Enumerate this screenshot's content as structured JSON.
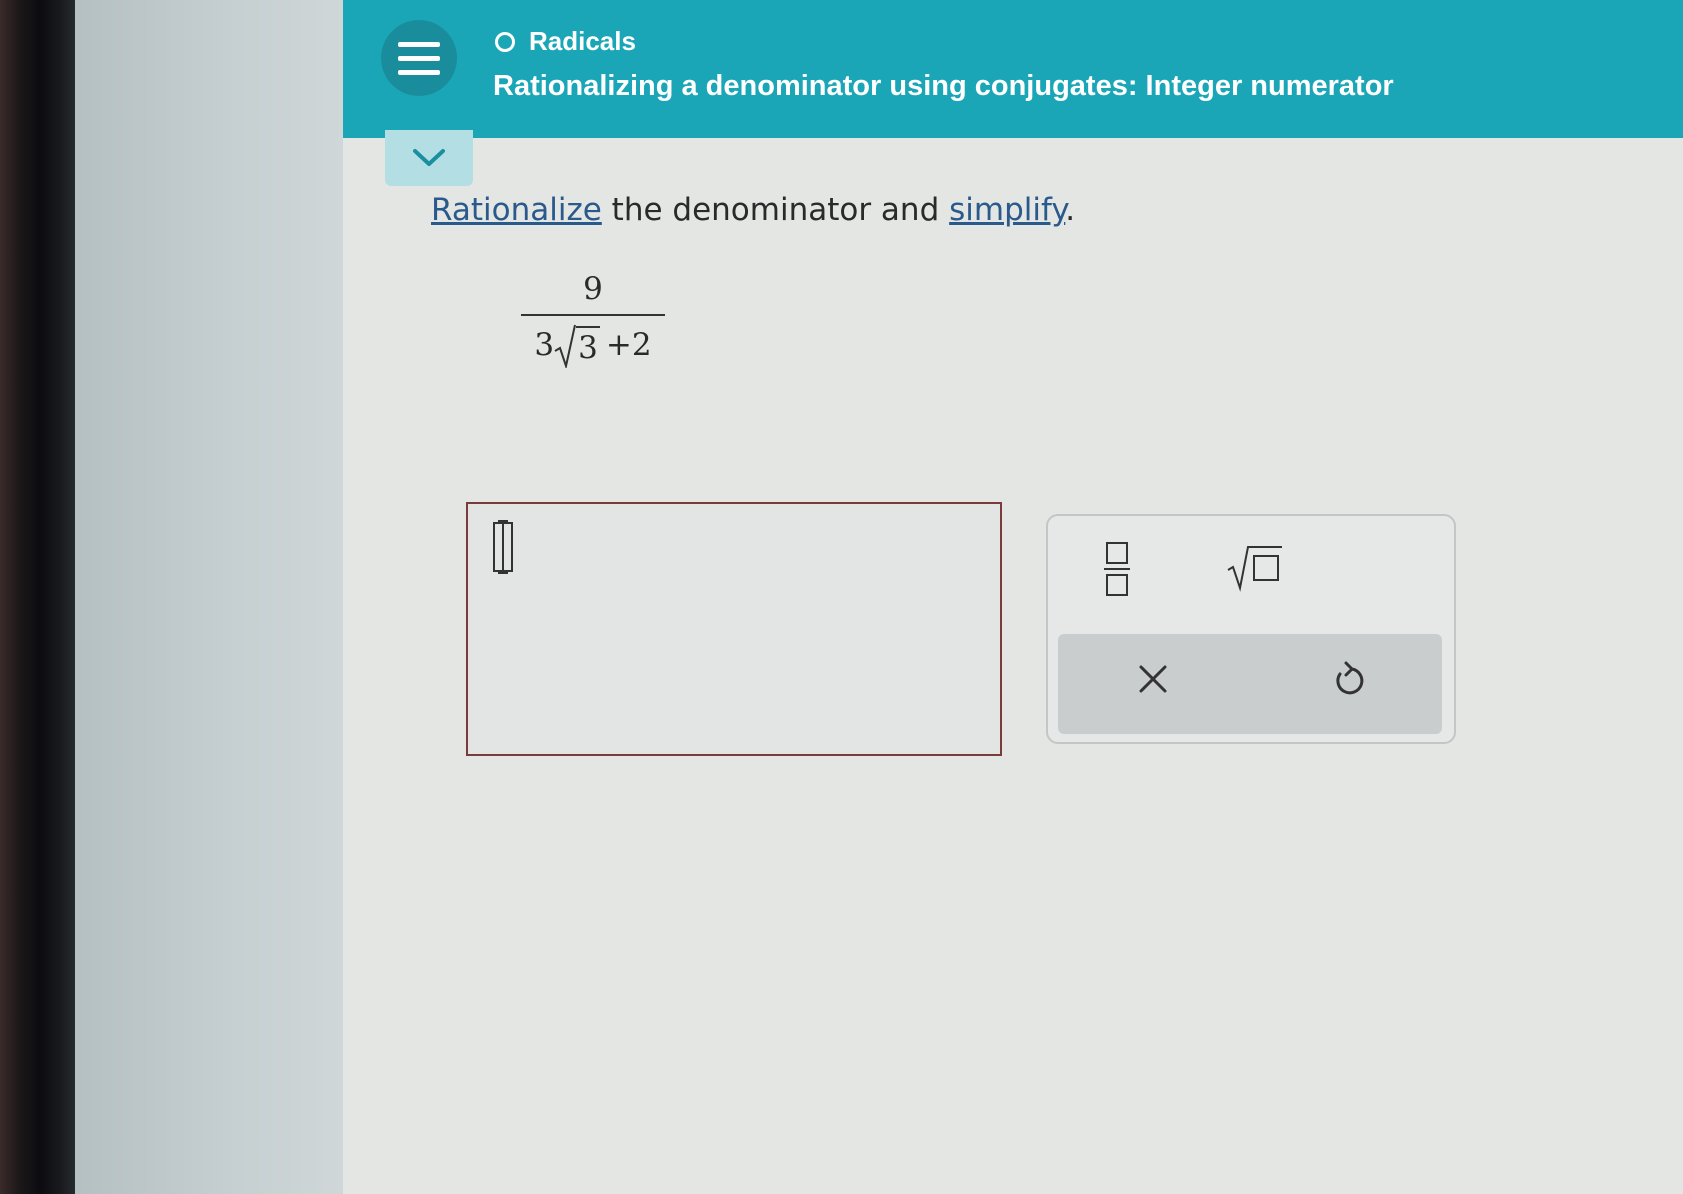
{
  "header": {
    "topic": "Radicals",
    "title": "Rationalizing a denominator using conjugates: Integer numerator"
  },
  "question": {
    "link_rationalize": "Rationalize",
    "middle_text": " the denominator and ",
    "link_simplify": "simplify",
    "end_text": "."
  },
  "expression": {
    "numerator": "9",
    "coefficient": "3",
    "radicand": "3",
    "plus_term": "+2"
  },
  "answer": {
    "value": ""
  },
  "palette": {
    "buttons": [
      "fraction-icon",
      "square-root-icon",
      "clear-x-icon",
      "undo-icon"
    ]
  },
  "colors": {
    "header_teal": "#1ba6b8",
    "menu_circle": "#1a8d9c",
    "link_blue": "#2a5a8c",
    "answer_border": "#7a3b3b"
  }
}
